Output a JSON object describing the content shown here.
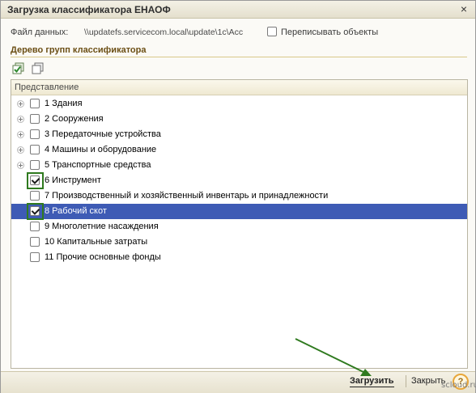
{
  "window": {
    "title": "Загрузка классификатора ЕНАОФ",
    "close_glyph": "×"
  },
  "file_row": {
    "label": "Файл данных:",
    "path": "\\\\updatefs.servicecom.local\\update\\1c\\Acc",
    "overwrite_label": "Переписывать объекты",
    "overwrite_checked": false
  },
  "section": {
    "title": "Дерево групп классификатора"
  },
  "toolbar": {
    "icons": [
      "check-all-icon",
      "uncheck-all-icon"
    ]
  },
  "tree": {
    "column_header": "Представление",
    "rows": [
      {
        "label": "1  Здания",
        "expandable": true,
        "checked": false,
        "selected": false,
        "highlighted": false
      },
      {
        "label": "2  Сооружения",
        "expandable": true,
        "checked": false,
        "selected": false,
        "highlighted": false
      },
      {
        "label": "3  Передаточные устройства",
        "expandable": true,
        "checked": false,
        "selected": false,
        "highlighted": false
      },
      {
        "label": "4  Машины и оборудование",
        "expandable": true,
        "checked": false,
        "selected": false,
        "highlighted": false
      },
      {
        "label": "5  Транспортные средства",
        "expandable": true,
        "checked": false,
        "selected": false,
        "highlighted": false
      },
      {
        "label": "6  Инструмент",
        "expandable": false,
        "checked": true,
        "selected": false,
        "highlighted": true
      },
      {
        "label": "7  Производственный и хозяйственный инвентарь и принадлежности",
        "expandable": false,
        "checked": false,
        "selected": false,
        "highlighted": false
      },
      {
        "label": "8  Рабочий скот",
        "expandable": false,
        "checked": true,
        "selected": true,
        "highlighted": true
      },
      {
        "label": "9  Многолетние насаждения",
        "expandable": false,
        "checked": false,
        "selected": false,
        "highlighted": false
      },
      {
        "label": "10  Капитальные затраты",
        "expandable": false,
        "checked": false,
        "selected": false,
        "highlighted": false
      },
      {
        "label": "11  Прочие основные фонды",
        "expandable": false,
        "checked": false,
        "selected": false,
        "highlighted": false
      }
    ]
  },
  "footer": {
    "load_label": "Загрузить",
    "close_label": "Закрыть",
    "help_glyph": "?"
  },
  "watermark": "scloud.ru",
  "colors": {
    "selection": "#3e5bb5",
    "highlight_border": "#2f7a1f",
    "section_title": "#6b4e14",
    "arrow": "#2f7a1f"
  }
}
